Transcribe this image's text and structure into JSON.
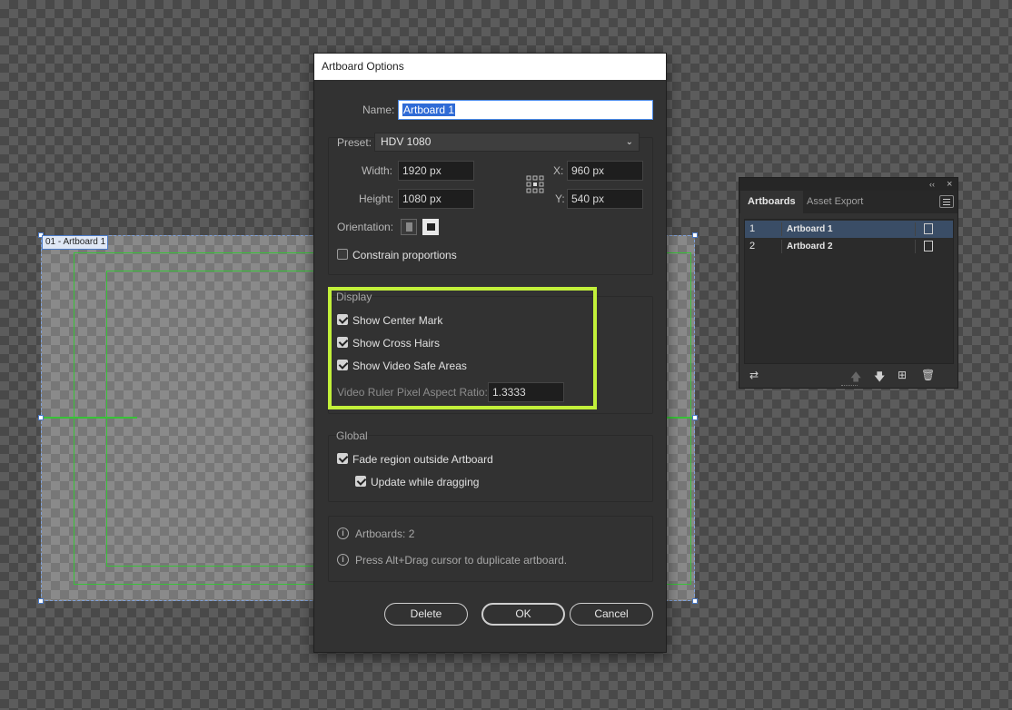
{
  "canvas": {
    "artboard_label": "01 - Artboard 1"
  },
  "dialog": {
    "title": "Artboard Options",
    "name_label": "Name:",
    "name_value": "Artboard 1",
    "preset_label": "Preset:",
    "preset_value": "HDV 1080",
    "width_label": "Width:",
    "width_value": "1920 px",
    "height_label": "Height:",
    "height_value": "1080 px",
    "x_label": "X:",
    "x_value": "960 px",
    "y_label": "Y:",
    "y_value": "540 px",
    "orientation_label": "Orientation:",
    "constrain_label": "Constrain proportions",
    "constrain_checked": false,
    "display": {
      "title": "Display",
      "show_center_mark": "Show Center Mark",
      "show_cross_hairs": "Show Cross Hairs",
      "show_video_safe_areas": "Show Video Safe Areas",
      "aspect_ratio_label": "Video Ruler Pixel Aspect Ratio:",
      "aspect_ratio_value": "1.3333"
    },
    "global": {
      "title": "Global",
      "fade_region": "Fade region outside Artboard",
      "update_while_dragging": "Update while dragging"
    },
    "info": {
      "artboards_count": "Artboards: 2",
      "hint": "Press Alt+Drag cursor to duplicate artboard."
    },
    "buttons": {
      "delete": "Delete",
      "ok": "OK",
      "cancel": "Cancel"
    },
    "highlight_color": "#c2f03a"
  },
  "panel": {
    "collapse_glyph": "‹‹",
    "close_glyph": "×",
    "tabs": [
      "Artboards",
      "Asset Export"
    ],
    "rows": [
      {
        "num": "1",
        "name": "Artboard 1",
        "selected": true
      },
      {
        "num": "2",
        "name": "Artboard 2",
        "selected": false
      }
    ],
    "selection_color": "#3a4d66"
  }
}
